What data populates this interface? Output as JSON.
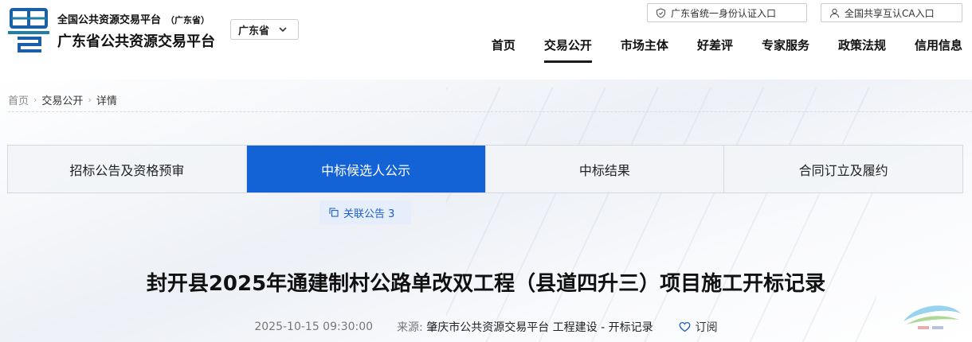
{
  "header": {
    "site_subtitle": "全国公共资源交易平台",
    "site_subtitle_region": "（广东省）",
    "site_title": "广东省公共资源交易平台",
    "region_select": {
      "value": "广东省"
    },
    "auth_identity": "广东省统一身份认证入口",
    "auth_ca": "全国共享互认CA入口"
  },
  "nav": {
    "items": [
      {
        "label": "首页"
      },
      {
        "label": "交易公开"
      },
      {
        "label": "市场主体"
      },
      {
        "label": "好差评"
      },
      {
        "label": "专家服务"
      },
      {
        "label": "政策法规"
      },
      {
        "label": "信用信息"
      }
    ]
  },
  "breadcrumb": {
    "home": "首页",
    "section": "交易公开",
    "current": "详情"
  },
  "tabs": [
    {
      "label": "招标公告及资格预审"
    },
    {
      "label": "中标候选人公示"
    },
    {
      "label": "中标结果"
    },
    {
      "label": "合同订立及履约"
    }
  ],
  "related": {
    "label": "关联公告 3"
  },
  "document": {
    "title": "封开县2025年通建制村公路单改双工程（县道四升三）项目施工开标记录",
    "date": "2025-10-15 09:30:00",
    "source_label": "来源:",
    "source": "肇庆市公共资源交易平台 工程建设 - 开标记录",
    "subscribe_label": "订阅"
  },
  "colors": {
    "accent": "#1463d6",
    "logo_teal": "#1f7fa8",
    "logo_blue": "#1b5fa6",
    "related_bg": "#e6eefb"
  },
  "icons": {
    "logo": "yue-logo-icon",
    "region_caret": "chevron-down-icon",
    "auth_identity": "shield-icon",
    "auth_ca": "user-icon",
    "related": "copy-icon",
    "subscribe": "heart-icon"
  }
}
